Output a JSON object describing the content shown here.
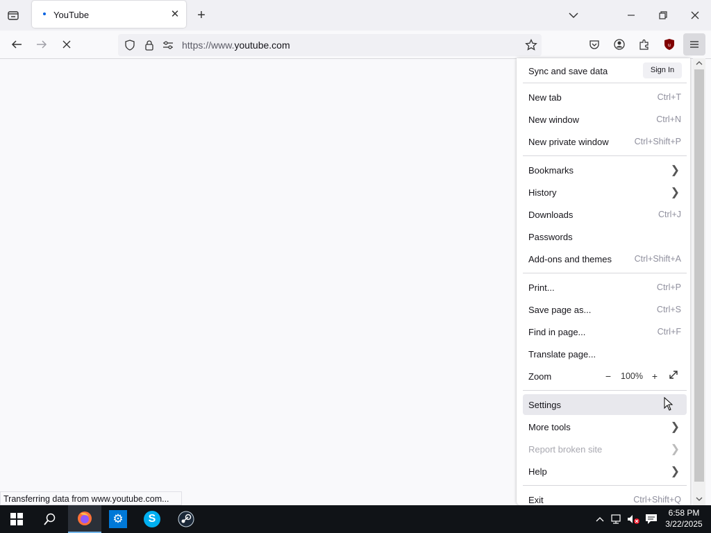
{
  "tab": {
    "title": "YouTube",
    "close_glyph": "✕"
  },
  "toolbar": {
    "url_prefix": "https://www.",
    "url_host": "youtube.com"
  },
  "status": "Transferring data from www.youtube.com...",
  "menu": {
    "sync_label": "Sync and save data",
    "signin_label": "Sign In",
    "items": [
      {
        "label": "New tab",
        "shortcut": "Ctrl+T"
      },
      {
        "label": "New window",
        "shortcut": "Ctrl+N"
      },
      {
        "label": "New private window",
        "shortcut": "Ctrl+Shift+P"
      },
      {
        "label": "Bookmarks",
        "shortcut": ""
      },
      {
        "label": "History",
        "shortcut": ""
      },
      {
        "label": "Downloads",
        "shortcut": "Ctrl+J"
      },
      {
        "label": "Passwords",
        "shortcut": ""
      },
      {
        "label": "Add-ons and themes",
        "shortcut": "Ctrl+Shift+A"
      },
      {
        "label": "Print...",
        "shortcut": "Ctrl+P"
      },
      {
        "label": "Save page as...",
        "shortcut": "Ctrl+S"
      },
      {
        "label": "Find in page...",
        "shortcut": "Ctrl+F"
      },
      {
        "label": "Translate page...",
        "shortcut": ""
      },
      {
        "label": "Settings",
        "shortcut": ""
      },
      {
        "label": "More tools",
        "shortcut": ""
      },
      {
        "label": "Report broken site",
        "shortcut": ""
      },
      {
        "label": "Help",
        "shortcut": ""
      },
      {
        "label": "Exit",
        "shortcut": "Ctrl+Shift+Q"
      }
    ],
    "zoom": {
      "label": "Zoom",
      "minus": "−",
      "value": "100%",
      "plus": "+"
    }
  },
  "taskbar": {
    "time": "6:58 PM",
    "date": "3/22/2025"
  },
  "colors": {
    "accent": "#0061e0",
    "taskbar": "#101317",
    "ublock": "#800000"
  }
}
